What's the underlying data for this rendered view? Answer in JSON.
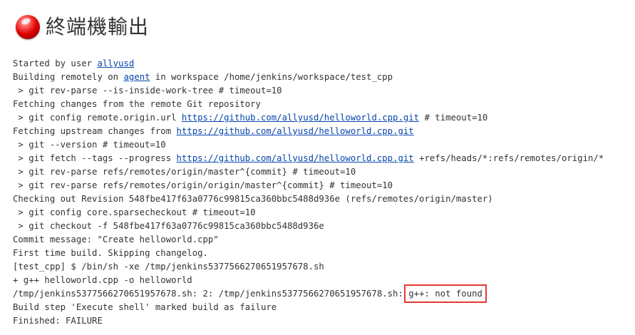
{
  "page": {
    "title": "終端機輸出",
    "status_icon": "red-ball-icon",
    "accent_colors": {
      "failure": "#e00000",
      "link": "#0645ad",
      "highlight_box": "#e53935"
    }
  },
  "console": {
    "lines": [
      {
        "pre": "Started by user ",
        "link": "allyusd",
        "post": ""
      },
      {
        "pre": "Building remotely on ",
        "link": "agent",
        "post": " in workspace /home/jenkins/workspace/test_cpp"
      },
      {
        "pre": " > git rev-parse --is-inside-work-tree # timeout=10"
      },
      {
        "pre": "Fetching changes from the remote Git repository"
      },
      {
        "pre": " > git config remote.origin.url ",
        "link": "https://github.com/allyusd/helloworld.cpp.git",
        "post": " # timeout=10"
      },
      {
        "pre": "Fetching upstream changes from ",
        "link": "https://github.com/allyusd/helloworld.cpp.git",
        "post": ""
      },
      {
        "pre": " > git --version # timeout=10"
      },
      {
        "pre": " > git fetch --tags --progress ",
        "link": "https://github.com/allyusd/helloworld.cpp.git",
        "post": " +refs/heads/*:refs/remotes/origin/*"
      },
      {
        "pre": " > git rev-parse refs/remotes/origin/master^{commit} # timeout=10"
      },
      {
        "pre": " > git rev-parse refs/remotes/origin/origin/master^{commit} # timeout=10"
      },
      {
        "pre": "Checking out Revision 548fbe417f63a0776c99815ca360bbc5488d936e (refs/remotes/origin/master)"
      },
      {
        "pre": " > git config core.sparsecheckout # timeout=10"
      },
      {
        "pre": " > git checkout -f 548fbe417f63a0776c99815ca360bbc5488d936e"
      },
      {
        "pre": "Commit message: \"Create helloworld.cpp\""
      },
      {
        "pre": "First time build. Skipping changelog."
      },
      {
        "pre": "[test_cpp] $ /bin/sh -xe /tmp/jenkins5377566270651957678.sh"
      },
      {
        "pre": "+ g++ helloworld.cpp -o helloworld"
      },
      {
        "pre": "/tmp/jenkins5377566270651957678.sh: 2: /tmp/jenkins5377566270651957678.sh: ",
        "highlight": "g++: not found"
      },
      {
        "pre": "Build step 'Execute shell' marked build as failure"
      },
      {
        "pre": "Finished: FAILURE"
      }
    ]
  }
}
